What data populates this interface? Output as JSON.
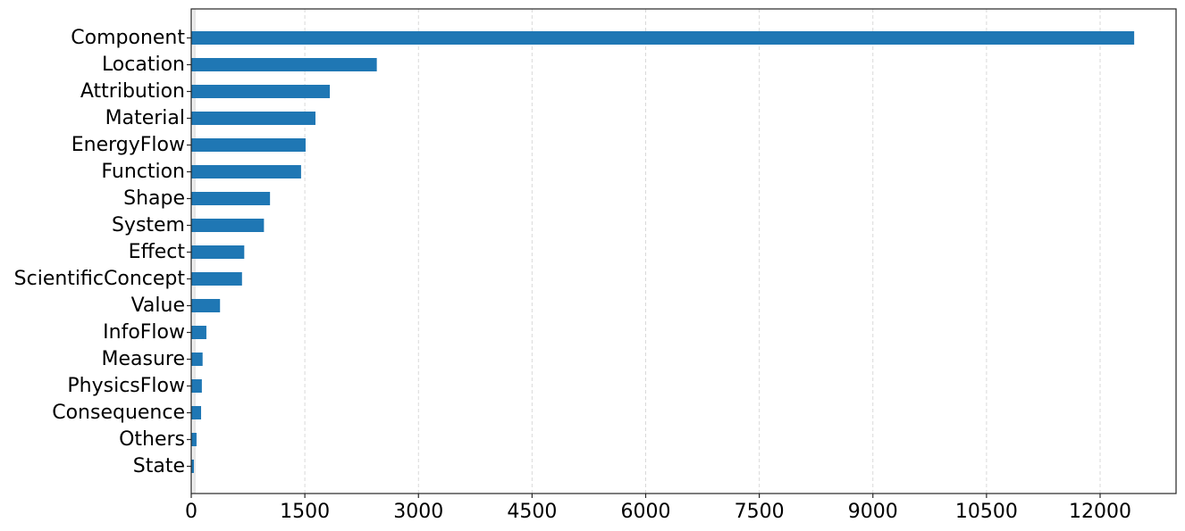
{
  "chart_data": {
    "type": "bar",
    "orientation": "horizontal",
    "title": "",
    "xlabel": "",
    "ylabel": "",
    "categories": [
      "Component",
      "Location",
      "Attribution",
      "Material",
      "EnergyFlow",
      "Function",
      "Shape",
      "System",
      "Effect",
      "ScientificConcept",
      "Value",
      "InfoFlow",
      "Measure",
      "PhysicsFlow",
      "Consequence",
      "Others",
      "State"
    ],
    "values": [
      12450,
      2450,
      1830,
      1640,
      1510,
      1450,
      1040,
      960,
      700,
      670,
      380,
      200,
      150,
      140,
      130,
      70,
      35
    ],
    "xlim": [
      0,
      13000
    ],
    "xticks": [
      0,
      1500,
      3000,
      4500,
      6000,
      7500,
      9000,
      10500,
      12000
    ],
    "xtick_labels": [
      "0",
      "1500",
      "3000",
      "4500",
      "6000",
      "7500",
      "9000",
      "10500",
      "12000"
    ],
    "grid": "x-axis dashed",
    "legend": "none",
    "colors": {
      "bar": "#1f77b4",
      "grid": "#d9d9d9",
      "spine": "#262626",
      "text": "#000000"
    }
  }
}
